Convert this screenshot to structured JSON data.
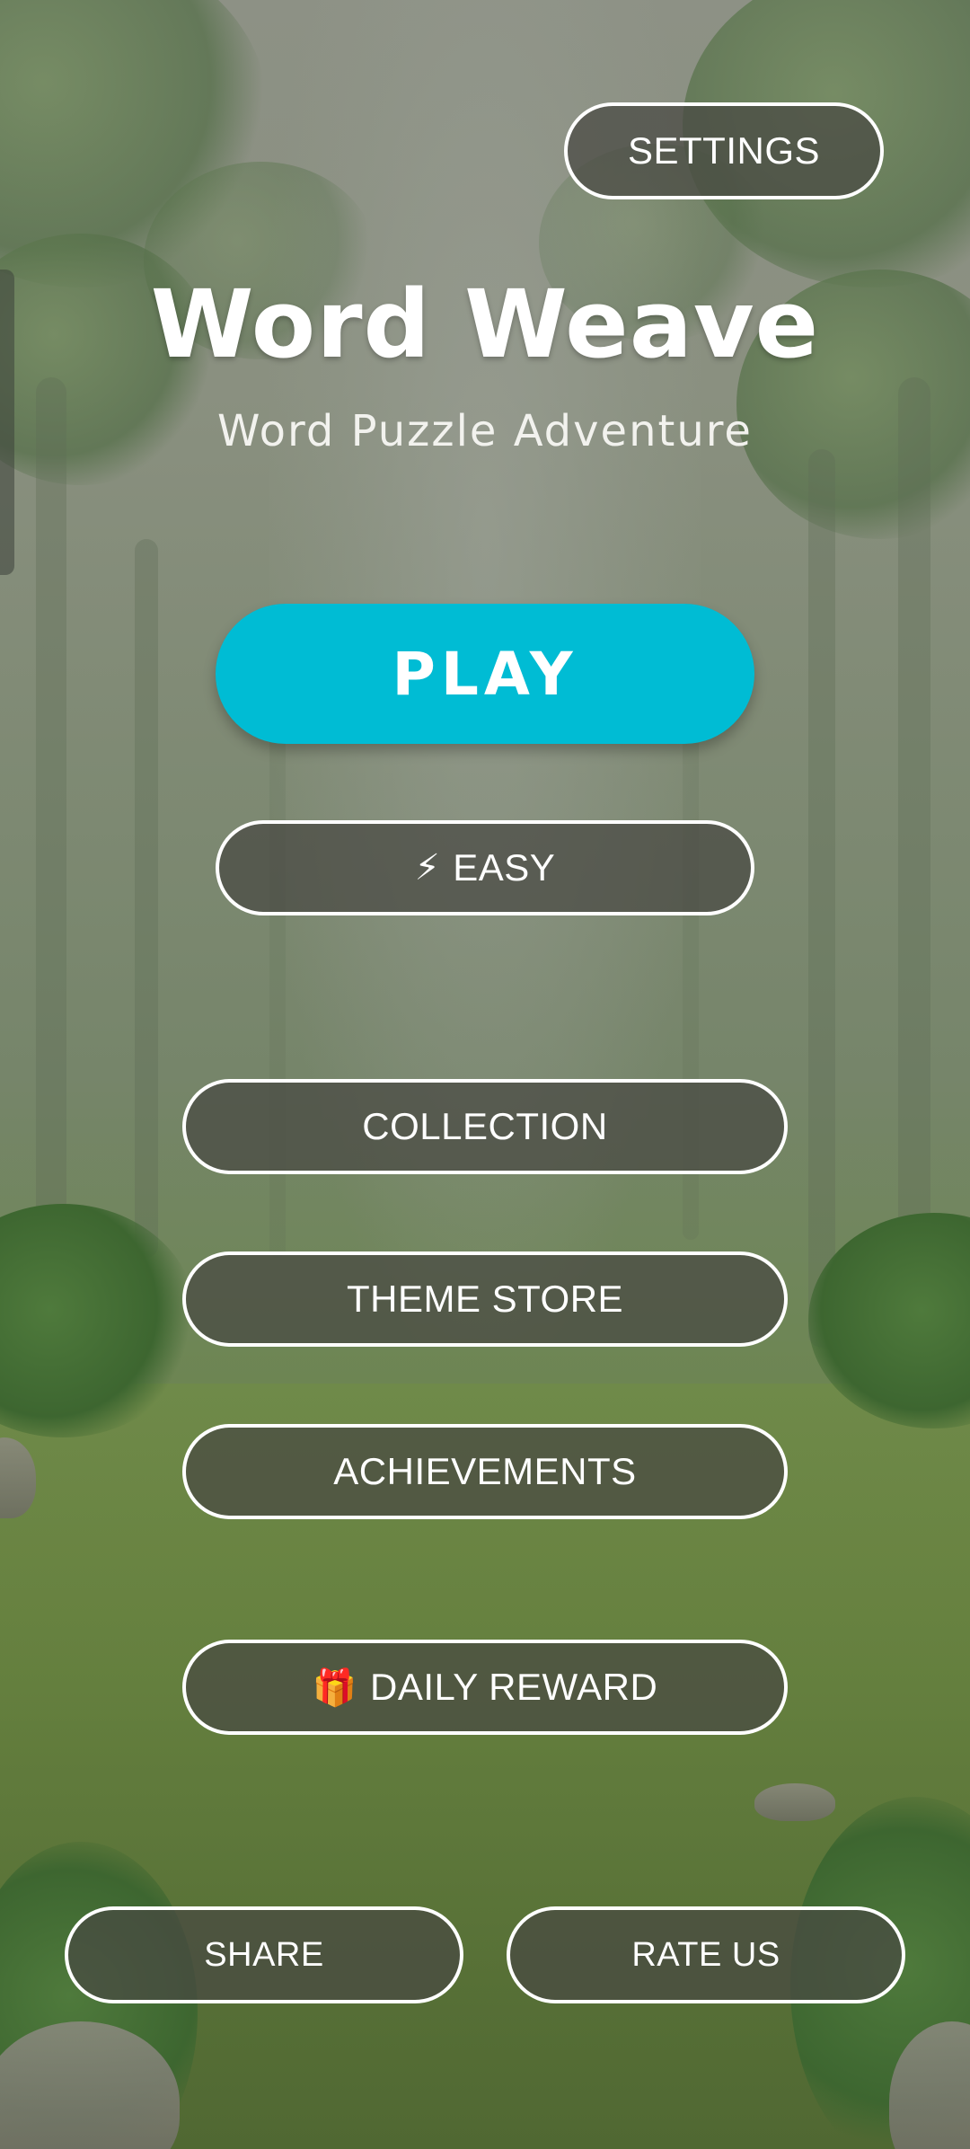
{
  "app": {
    "title": "Word Weave",
    "subtitle": "Word Puzzle Adventure"
  },
  "header": {
    "settings_label": "SETTINGS"
  },
  "main": {
    "play_label": "PLAY",
    "difficulty": {
      "icon": "lightning-icon",
      "icon_glyph": "⚡",
      "label": "EASY"
    },
    "menu": {
      "collection_label": "COLLECTION",
      "theme_store_label": "THEME STORE",
      "achievements_label": "ACHIEVEMENTS"
    },
    "daily_reward": {
      "icon": "gift-icon",
      "icon_glyph": "🎁",
      "label": "DAILY REWARD"
    }
  },
  "footer": {
    "share_label": "SHARE",
    "rate_us_label": "RATE US"
  },
  "colors": {
    "play_button": "#00bcd4",
    "button_border": "#ffffff",
    "text": "#ffffff"
  }
}
